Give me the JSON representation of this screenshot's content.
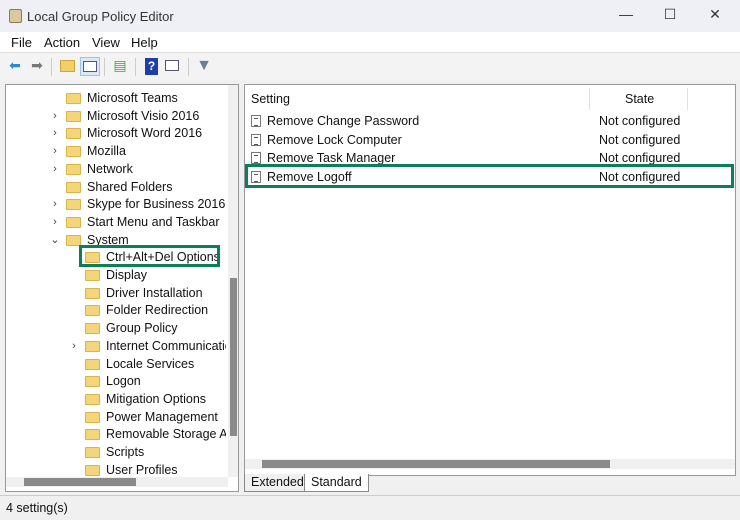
{
  "window": {
    "title": "Local Group Policy Editor",
    "minimize": "—",
    "maximize": "☐",
    "close": "✕"
  },
  "menu": [
    "File",
    "Action",
    "View",
    "Help"
  ],
  "toolbar": {
    "icons": [
      "back-arrow-icon",
      "forward-arrow-icon",
      "up-folder-icon",
      "show-hide-tree-icon",
      "export-list-icon",
      "help-icon",
      "show-action-pane-icon",
      "filter-icon"
    ]
  },
  "tree": [
    {
      "label": "Microsoft Teams",
      "level": 1,
      "chev": ""
    },
    {
      "label": "Microsoft Visio 2016",
      "level": 1,
      "chev": ">"
    },
    {
      "label": "Microsoft Word 2016",
      "level": 1,
      "chev": ">"
    },
    {
      "label": "Mozilla",
      "level": 1,
      "chev": ">"
    },
    {
      "label": "Network",
      "level": 1,
      "chev": ">"
    },
    {
      "label": "Shared Folders",
      "level": 1,
      "chev": ""
    },
    {
      "label": "Skype for Business 2016",
      "level": 1,
      "chev": ">"
    },
    {
      "label": "Start Menu and Taskbar",
      "level": 1,
      "chev": ">"
    },
    {
      "label": "System",
      "level": 1,
      "chev": "v"
    },
    {
      "label": "Ctrl+Alt+Del Options",
      "level": 2,
      "chev": "",
      "selected": true
    },
    {
      "label": "Display",
      "level": 2,
      "chev": ""
    },
    {
      "label": "Driver Installation",
      "level": 2,
      "chev": ""
    },
    {
      "label": "Folder Redirection",
      "level": 2,
      "chev": ""
    },
    {
      "label": "Group Policy",
      "level": 2,
      "chev": ""
    },
    {
      "label": "Internet Communication Management",
      "level": 2,
      "chev": ">"
    },
    {
      "label": "Locale Services",
      "level": 2,
      "chev": ""
    },
    {
      "label": "Logon",
      "level": 2,
      "chev": ""
    },
    {
      "label": "Mitigation Options",
      "level": 2,
      "chev": ""
    },
    {
      "label": "Power Management",
      "level": 2,
      "chev": ""
    },
    {
      "label": "Removable Storage Access",
      "level": 2,
      "chev": ""
    },
    {
      "label": "Scripts",
      "level": 2,
      "chev": ""
    },
    {
      "label": "User Profiles",
      "level": 2,
      "chev": ""
    }
  ],
  "list": {
    "columns": [
      "Setting",
      "State"
    ],
    "rows": [
      {
        "setting": "Remove Change Password",
        "state": "Not configured"
      },
      {
        "setting": "Remove Lock Computer",
        "state": "Not configured"
      },
      {
        "setting": "Remove Task Manager",
        "state": "Not configured"
      },
      {
        "setting": "Remove Logoff",
        "state": "Not configured",
        "highlighted": true
      }
    ]
  },
  "tabs": [
    "Extended",
    "Standard"
  ],
  "active_tab": "Standard",
  "status": "4 setting(s)",
  "colors": {
    "highlight": "#0b7f56"
  }
}
